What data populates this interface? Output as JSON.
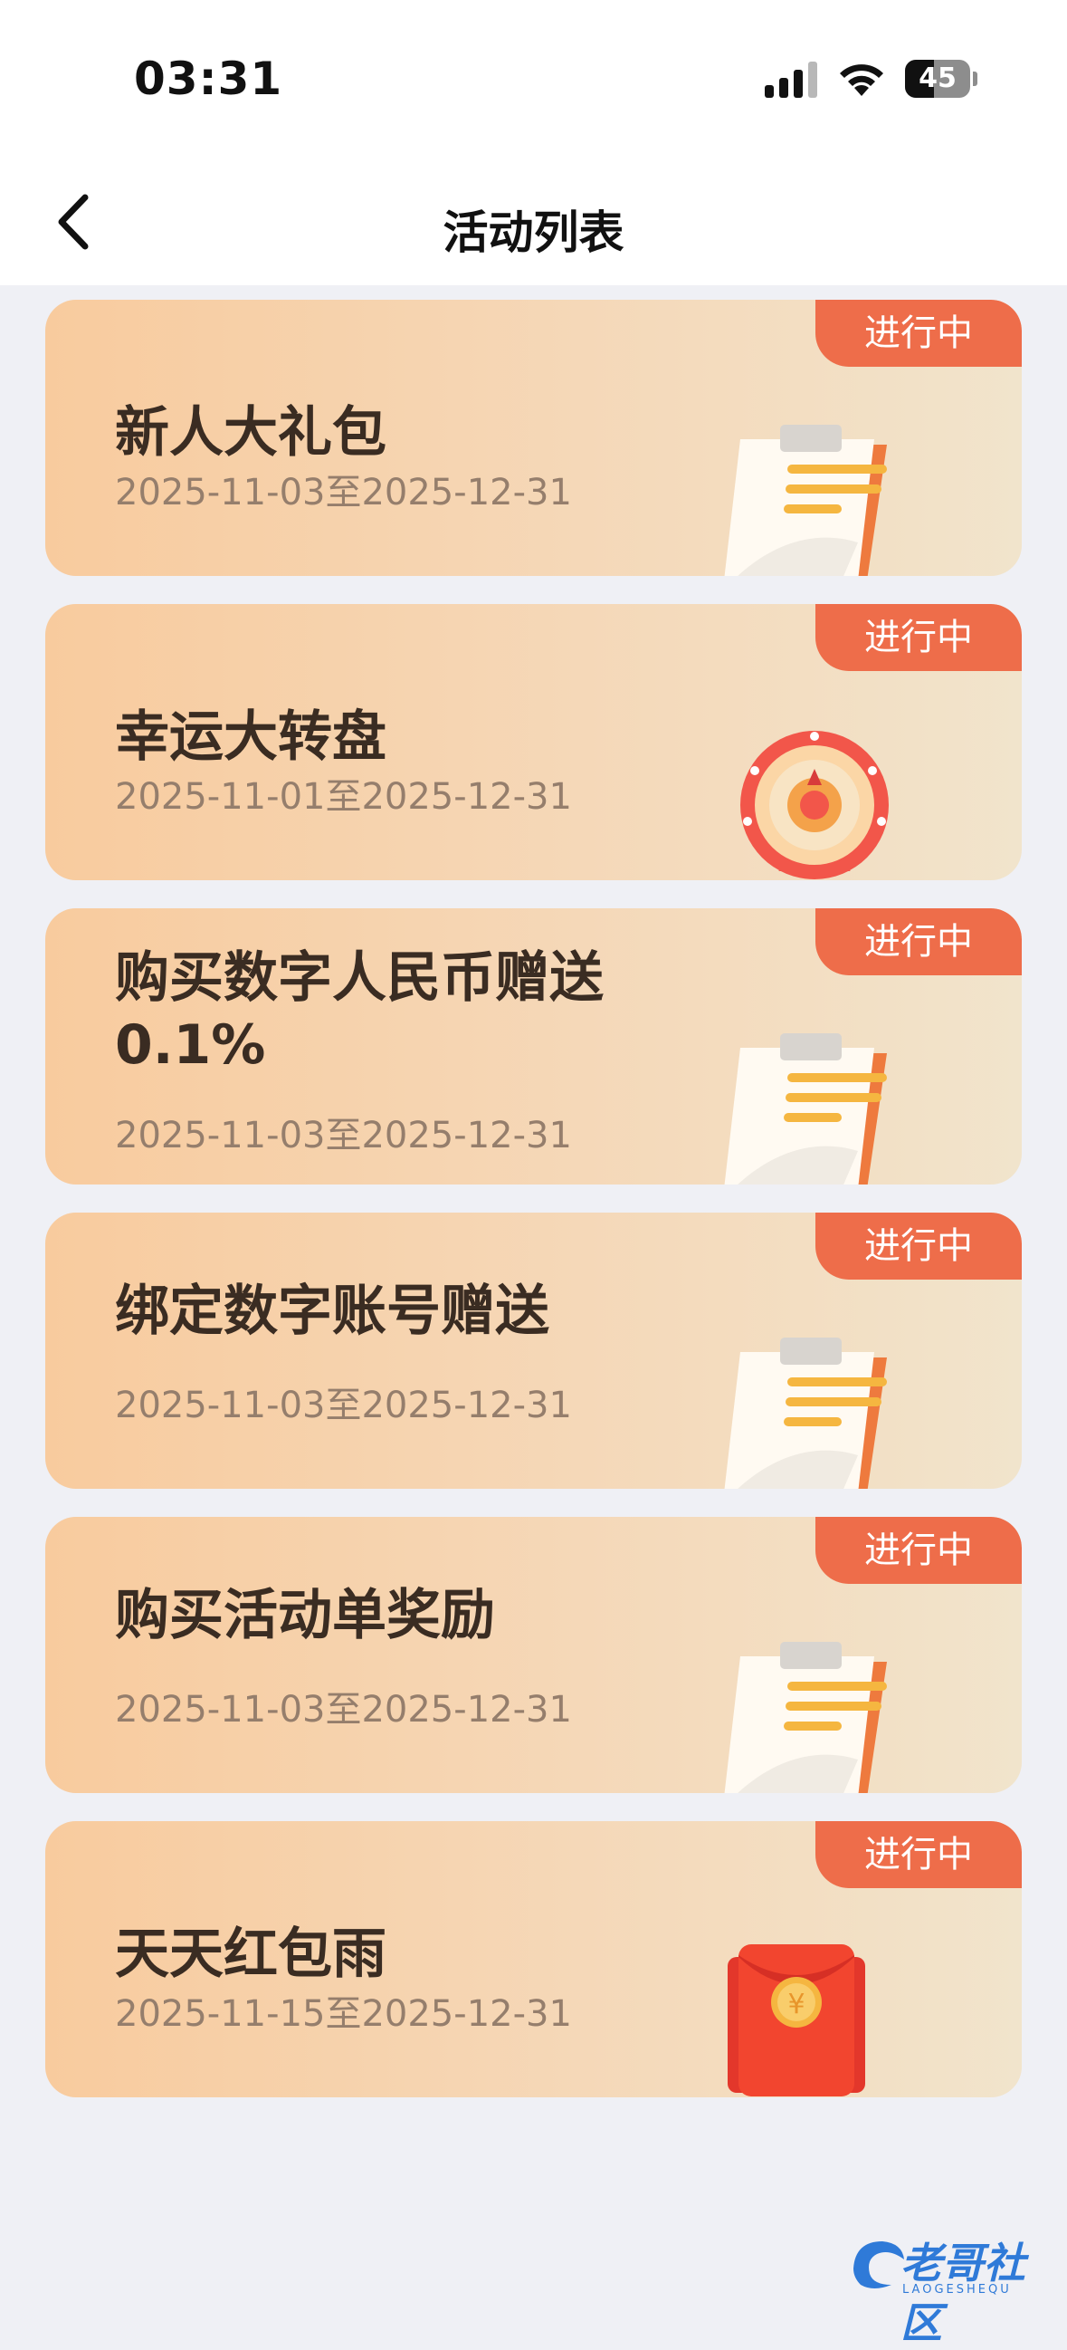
{
  "status": {
    "time": "03:31",
    "battery": "45",
    "battery_level": 0.45
  },
  "nav": {
    "title": "活动列表"
  },
  "activities": [
    {
      "title": "新人大礼包",
      "date": "2025-11-03至2025-12-31",
      "status": "进行中",
      "icon": "clipboard-icon"
    },
    {
      "title": "幸运大转盘",
      "date": "2025-11-01至2025-12-31",
      "status": "进行中",
      "icon": "prize-wheel-icon"
    },
    {
      "title": "购买数字人民币赠送0.1%",
      "date": "2025-11-03至2025-12-31",
      "status": "进行中",
      "icon": "clipboard-icon"
    },
    {
      "title": "绑定数字账号赠送",
      "date": "2025-11-03至2025-12-31",
      "status": "进行中",
      "icon": "clipboard-icon"
    },
    {
      "title": "购买活动单奖励",
      "date": "2025-11-03至2025-12-31",
      "status": "进行中",
      "icon": "clipboard-icon"
    },
    {
      "title": "天天红包雨",
      "date": "2025-11-15至2025-12-31",
      "status": "进行中",
      "icon": "red-envelope-icon"
    }
  ],
  "watermark": {
    "text": "老哥社区",
    "sub": "LAOGESHEQU"
  },
  "colors": {
    "badge": "#ee6d4a",
    "card_start": "#f8cb9e",
    "card_end": "#f1e4cc",
    "title": "#3a2c22",
    "date": "#957e6c"
  }
}
